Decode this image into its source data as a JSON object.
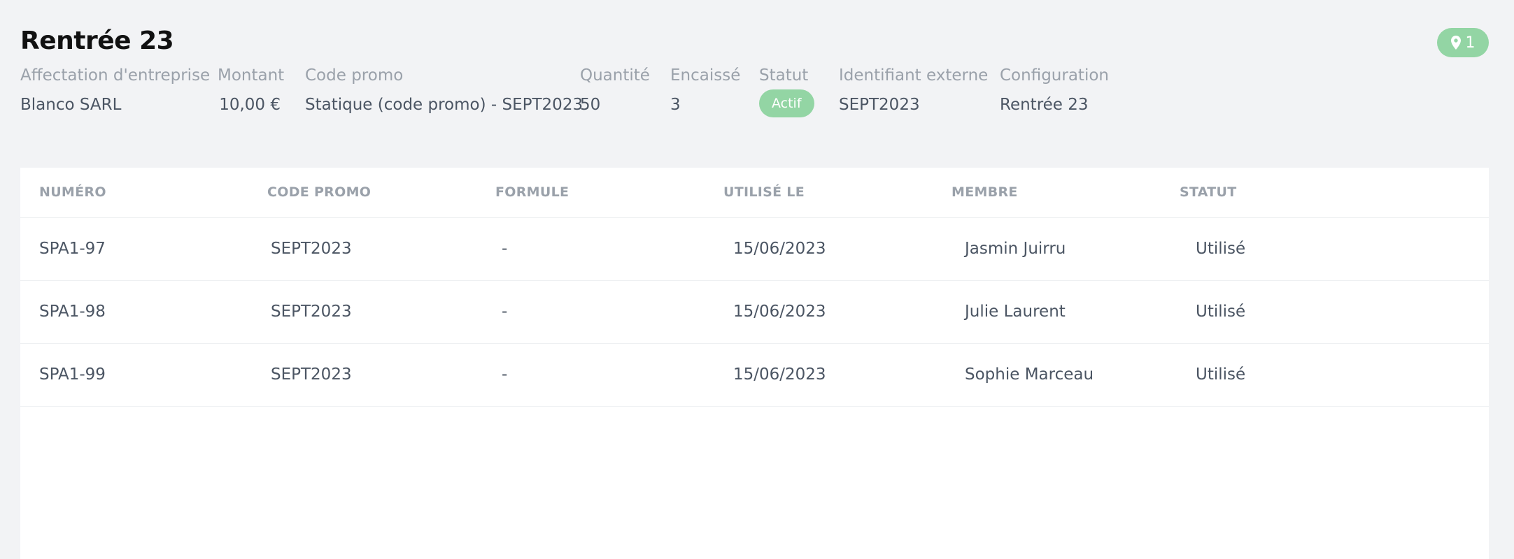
{
  "header": {
    "title": "Rentrée 23",
    "location_count": "1"
  },
  "summary": {
    "company_label": "Affectation d'entreprise",
    "company_value": "Blanco SARL",
    "amount_label": "Montant",
    "amount_value": "10,00 €",
    "promo_label": "Code promo",
    "promo_value": "Statique (code promo) - SEPT2023",
    "quantity_label": "Quantité",
    "quantity_value": "50",
    "collected_label": "Encaissé",
    "collected_value": "3",
    "status_label": "Statut",
    "status_value": "Actif",
    "external_id_label": "Identifiant externe",
    "external_id_value": "SEPT2023",
    "configuration_label": "Configuration",
    "configuration_value": "Rentrée 23"
  },
  "table": {
    "columns": [
      "NUMÉRO",
      "CODE PROMO",
      "FORMULE",
      "UTILISÉ LE",
      "MEMBRE",
      "STATUT"
    ],
    "rows": [
      {
        "number": "SPA1-97",
        "promo_code": "SEPT2023",
        "formula": "-",
        "used_on": "15/06/2023",
        "member": "Jasmin Juirru",
        "status": "Utilisé"
      },
      {
        "number": "SPA1-98",
        "promo_code": "SEPT2023",
        "formula": "-",
        "used_on": "15/06/2023",
        "member": "Julie Laurent",
        "status": "Utilisé"
      },
      {
        "number": "SPA1-99",
        "promo_code": "SEPT2023",
        "formula": "-",
        "used_on": "15/06/2023",
        "member": "Sophie Marceau",
        "status": "Utilisé"
      }
    ]
  },
  "colors": {
    "accent_green": "#93d5a4",
    "background": "#f2f3f5",
    "muted_text": "#9aa1aa",
    "body_text": "#4b5563"
  },
  "icons": {
    "location": "map-marker-icon"
  }
}
